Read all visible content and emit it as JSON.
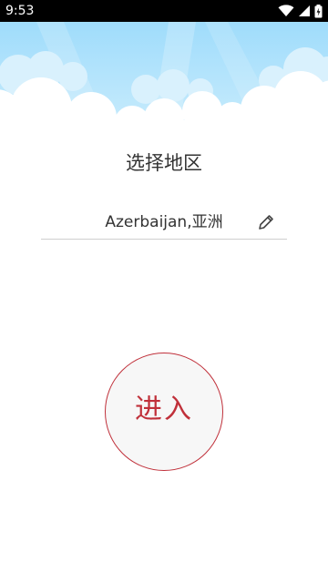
{
  "status_bar": {
    "time": "9:53",
    "icons": [
      "wifi-icon",
      "signal-icon",
      "battery-icon"
    ]
  },
  "colors": {
    "sky_top": "#9fdcfb",
    "sky_bottom": "#c9ecfd",
    "accent": "#c0303a",
    "text": "#333333",
    "divider": "#cfcfcf"
  },
  "main": {
    "title": "选择地区",
    "region_value": "Azerbaijan,亚洲",
    "edit_icon": "pencil-icon",
    "enter_label": "进入"
  }
}
